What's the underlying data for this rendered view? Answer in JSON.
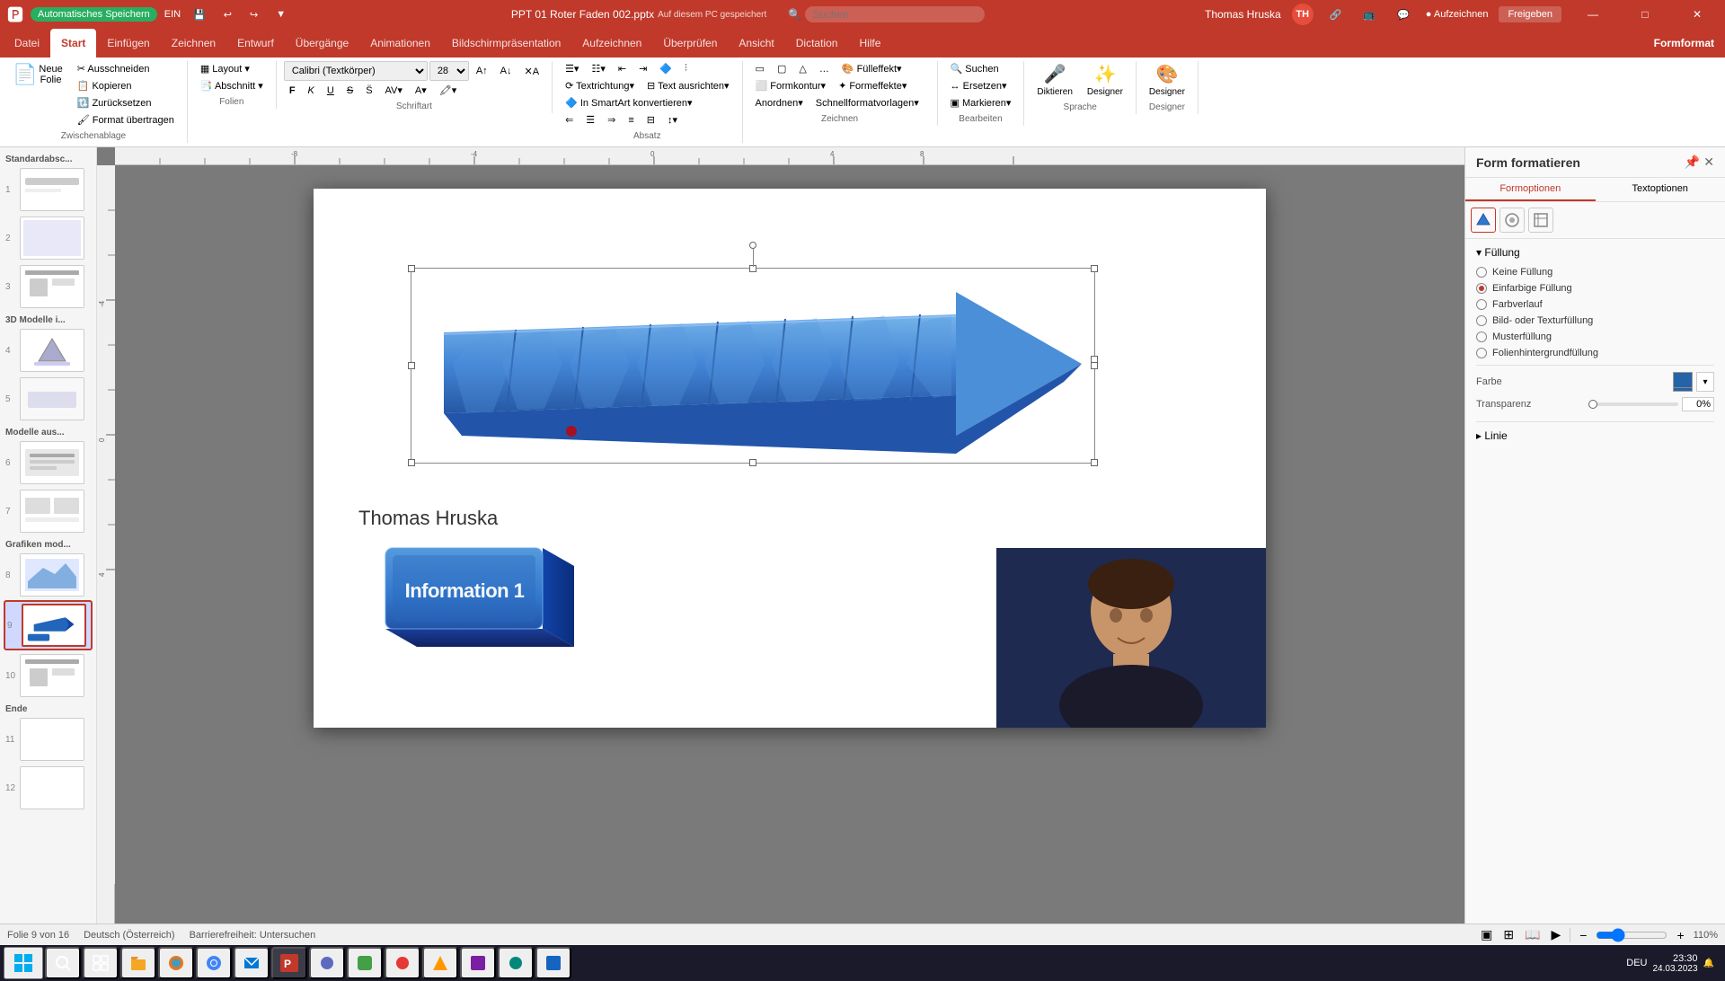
{
  "titlebar": {
    "autosave_label": "Automatisches Speichern",
    "autosave_state": "EIN",
    "filename": "PPT 01 Roter Faden 002.pptx",
    "location": "Auf diesem PC gespeichert",
    "search_placeholder": "Suchen",
    "user": "Thomas Hruska",
    "minimize": "—",
    "maximize": "□",
    "close": "✕"
  },
  "ribbon": {
    "tabs": [
      {
        "id": "datei",
        "label": "Datei"
      },
      {
        "id": "start",
        "label": "Start",
        "active": true
      },
      {
        "id": "einfuegen",
        "label": "Einfügen"
      },
      {
        "id": "zeichnen",
        "label": "Zeichnen"
      },
      {
        "id": "entwurf",
        "label": "Entwurf"
      },
      {
        "id": "uebergaenge",
        "label": "Übergänge"
      },
      {
        "id": "animationen",
        "label": "Animationen"
      },
      {
        "id": "bildschirm",
        "label": "Bildschirmpräsentation"
      },
      {
        "id": "aufzeichnen",
        "label": "Aufzeichnen"
      },
      {
        "id": "ueberpruefen",
        "label": "Überprüfen"
      },
      {
        "id": "ansicht",
        "label": "Ansicht"
      },
      {
        "id": "dictation",
        "label": "Dictation"
      },
      {
        "id": "hilfe",
        "label": "Hilfe"
      },
      {
        "id": "formformat",
        "label": "Formformat",
        "special": true
      }
    ],
    "groups": {
      "zwischenablage": {
        "label": "Zwischenablage",
        "buttons": [
          "Ausschneiden",
          "Kopieren",
          "Zurücksetzen",
          "Format übertragen",
          "Neue Folie"
        ]
      },
      "folien": {
        "label": "Folien",
        "buttons": [
          "Layout",
          "Abschnitt"
        ]
      },
      "schriftart": {
        "label": "Schriftart",
        "font": "Calibri (Textkörper)",
        "size": "28",
        "buttons": [
          "F",
          "K",
          "U",
          "S"
        ]
      },
      "absatz": {
        "label": "Absatz"
      },
      "zeichnen": {
        "label": "Zeichnen"
      },
      "bearbeiten": {
        "label": "Bearbeiten",
        "buttons": [
          "Suchen",
          "Ersetzen",
          "Markieren"
        ]
      },
      "sprache": {
        "label": "Sprache",
        "buttons": [
          "Diktieren",
          "Designer"
        ]
      }
    }
  },
  "slide_panel": {
    "groups": [
      {
        "label": "Standardabsc...",
        "slides": [
          {
            "num": 1
          }
        ]
      },
      {
        "label": "",
        "slides": [
          {
            "num": 2
          },
          {
            "num": 3
          }
        ]
      },
      {
        "label": "3D Modelle i...",
        "slides": [
          {
            "num": 4
          },
          {
            "num": 5
          }
        ]
      },
      {
        "label": "Modelle aus...",
        "slides": [
          {
            "num": 6
          },
          {
            "num": 7,
            "star": true
          }
        ]
      },
      {
        "label": "Grafiken mod...",
        "slides": [
          {
            "num": 8
          },
          {
            "num": 9,
            "active": true
          }
        ]
      },
      {
        "label": "",
        "slides": [
          {
            "num": 10
          }
        ]
      },
      {
        "label": "Ende",
        "slides": [
          {
            "num": 11
          },
          {
            "num": 12
          }
        ]
      }
    ]
  },
  "slide": {
    "arrow_text": "",
    "info_block_text": "Information 1",
    "author": "Thomas Hruska"
  },
  "right_panel": {
    "title": "Form formatieren",
    "tabs": [
      "Formoptionen",
      "Textoptionen"
    ],
    "active_tab": "Formoptionen",
    "icons": [
      {
        "id": "fill-icon",
        "symbol": "⬟",
        "active": true
      },
      {
        "id": "effects-icon",
        "symbol": "⬡"
      },
      {
        "id": "size-icon",
        "symbol": "⊞"
      }
    ],
    "sections": {
      "fuellung": {
        "title": "Füllung",
        "options": [
          {
            "id": "keine-fuellung",
            "label": "Keine Füllung",
            "selected": false
          },
          {
            "id": "einfarbige-fuellung",
            "label": "Einfarbige Füllung",
            "selected": true
          },
          {
            "id": "farbverlauf",
            "label": "Farbverlauf",
            "selected": false
          },
          {
            "id": "bild-textur",
            "label": "Bild- oder Texturfüllung",
            "selected": false
          },
          {
            "id": "musterfuellung",
            "label": "Musterfüllung",
            "selected": false
          },
          {
            "id": "folienhintergrund",
            "label": "Folienhintergrundfüllung",
            "selected": false
          }
        ],
        "farbe_label": "Farbe",
        "transparenz_label": "Transparenz",
        "transparenz_value": "0%",
        "color": "#2563a8"
      },
      "linie": {
        "title": "Linie"
      }
    }
  },
  "status_bar": {
    "slide_info": "Folie 9 von 16",
    "language": "Deutsch (Österreich)",
    "accessibility": "Barrierefreiheit: Untersuchen",
    "zoom": "110%"
  },
  "taskbar": {
    "time": "23:30",
    "date": "24.03.2023",
    "apps": [
      "⊞",
      "📁",
      "🦊",
      "🌐",
      "📧",
      "📊",
      "🎙",
      "🔵",
      "📝",
      "🔷",
      "🎯",
      "🔧",
      "⚙",
      "💬",
      "🟢",
      "🔒",
      "🟣",
      "🖥",
      "📱",
      "🎮"
    ]
  }
}
